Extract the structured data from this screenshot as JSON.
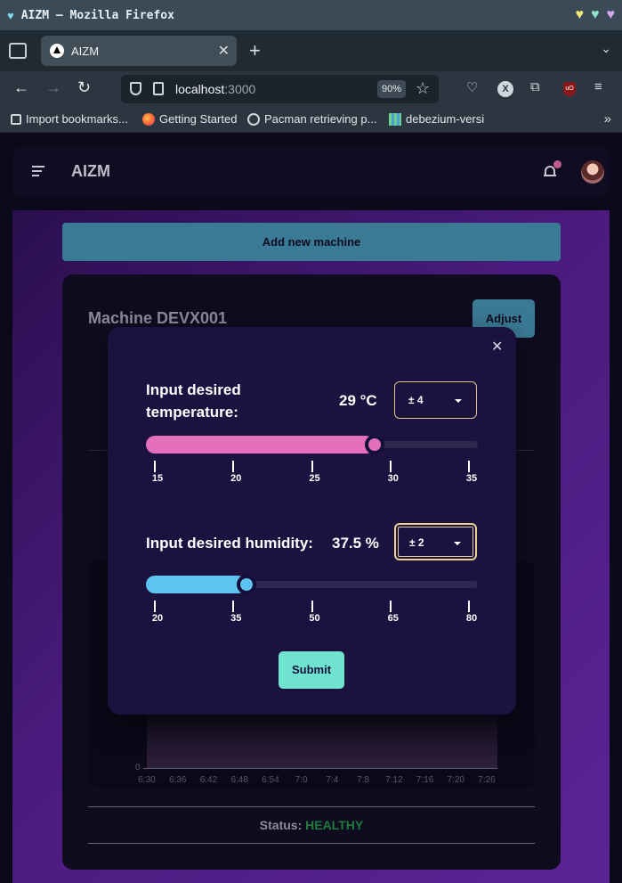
{
  "browser": {
    "window_title": "AIZM — Mozilla Firefox",
    "tab_label": "AIZM",
    "url_host": "localhost",
    "url_port": ":3000",
    "zoom": "90%",
    "bookmarks": [
      {
        "label": "Import bookmarks...",
        "icon": "import-icon"
      },
      {
        "label": "Getting Started",
        "icon": "firefox-icon"
      },
      {
        "label": "Pacman retrieving p...",
        "icon": "globe-icon"
      },
      {
        "label": "debezium-versi",
        "icon": "grid-icon"
      }
    ]
  },
  "app": {
    "brand": "AIZM",
    "add_machine_label": "Add new machine",
    "machine_title": "Machine DEVX001",
    "adjust_label": "Adjust",
    "status_label": "Status:",
    "status_value": "HEALTHY",
    "status_color": "#1e7c3c",
    "chart_y_zero": "0",
    "chart_x_ticks": [
      "6:30",
      "6:36",
      "6:42",
      "6:48",
      "6:54",
      "7:0",
      "7:4",
      "7:8",
      "7:12",
      "7:16",
      "7:20",
      "7:26"
    ]
  },
  "modal": {
    "temperature": {
      "label_line1": "Input desired",
      "label_line2": "temperature:",
      "value": "29 °C",
      "tolerance": "± 4",
      "slider_min": 15,
      "slider_max": 35,
      "slider_value": 29,
      "tick_labels": [
        "15",
        "20",
        "25",
        "30",
        "35"
      ],
      "fill_color": "#e36fbd"
    },
    "humidity": {
      "label": "Input desired humidity:",
      "value": "37.5 %",
      "tolerance": "± 2",
      "slider_min": 20,
      "slider_max": 80,
      "slider_value": 37.5,
      "tick_labels": [
        "20",
        "35",
        "50",
        "65",
        "80"
      ],
      "fill_color": "#5ec3f0"
    },
    "submit_label": "Submit"
  }
}
